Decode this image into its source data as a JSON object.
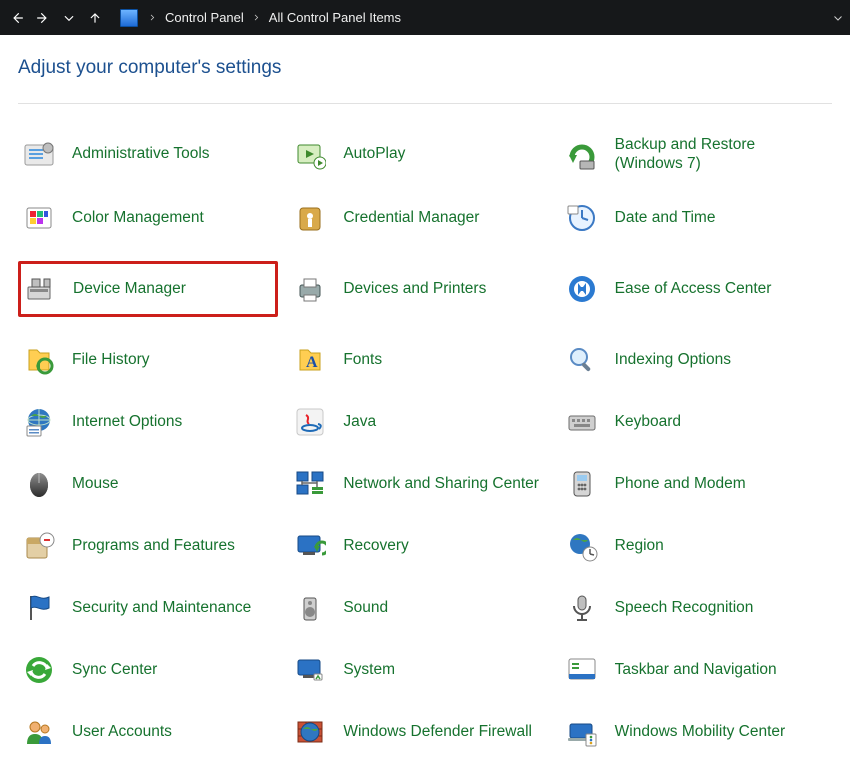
{
  "nav": {
    "back": "Back",
    "forward": "Forward",
    "recent": "Recent locations",
    "up": "Up"
  },
  "breadcrumb": {
    "root": "Control Panel",
    "leaf": "All Control Panel Items"
  },
  "heading": "Adjust your computer's settings",
  "items": [
    {
      "id": "administrative-tools",
      "label": "Administrative Tools",
      "icon": "admin-tools-icon"
    },
    {
      "id": "autoplay",
      "label": "AutoPlay",
      "icon": "autoplay-icon"
    },
    {
      "id": "backup-restore",
      "label": "Backup and Restore (Windows 7)",
      "icon": "backup-icon"
    },
    {
      "id": "color-management",
      "label": "Color Management",
      "icon": "color-icon"
    },
    {
      "id": "credential-manager",
      "label": "Credential Manager",
      "icon": "credential-icon"
    },
    {
      "id": "date-time",
      "label": "Date and Time",
      "icon": "clock-icon"
    },
    {
      "id": "device-manager",
      "label": "Device Manager",
      "icon": "device-manager-icon",
      "highlight": true
    },
    {
      "id": "devices-printers",
      "label": "Devices and Printers",
      "icon": "printer-icon"
    },
    {
      "id": "ease-of-access",
      "label": "Ease of Access Center",
      "icon": "ease-access-icon"
    },
    {
      "id": "file-history",
      "label": "File History",
      "icon": "file-history-icon"
    },
    {
      "id": "fonts",
      "label": "Fonts",
      "icon": "font-icon"
    },
    {
      "id": "indexing-options",
      "label": "Indexing Options",
      "icon": "indexing-icon"
    },
    {
      "id": "internet-options",
      "label": "Internet Options",
      "icon": "globe-icon"
    },
    {
      "id": "java",
      "label": "Java",
      "icon": "java-icon"
    },
    {
      "id": "keyboard",
      "label": "Keyboard",
      "icon": "keyboard-icon"
    },
    {
      "id": "mouse",
      "label": "Mouse",
      "icon": "mouse-icon"
    },
    {
      "id": "network-sharing",
      "label": "Network and Sharing Center",
      "icon": "network-icon"
    },
    {
      "id": "phone-modem",
      "label": "Phone and Modem",
      "icon": "phone-icon"
    },
    {
      "id": "programs-features",
      "label": "Programs and Features",
      "icon": "programs-icon"
    },
    {
      "id": "recovery",
      "label": "Recovery",
      "icon": "recovery-icon"
    },
    {
      "id": "region",
      "label": "Region",
      "icon": "region-icon"
    },
    {
      "id": "security-maintenance",
      "label": "Security and Maintenance",
      "icon": "flag-icon"
    },
    {
      "id": "sound",
      "label": "Sound",
      "icon": "speaker-icon"
    },
    {
      "id": "speech-recognition",
      "label": "Speech Recognition",
      "icon": "mic-icon"
    },
    {
      "id": "sync-center",
      "label": "Sync Center",
      "icon": "sync-icon"
    },
    {
      "id": "system",
      "label": "System",
      "icon": "system-icon"
    },
    {
      "id": "taskbar-navigation",
      "label": "Taskbar and Navigation",
      "icon": "taskbar-icon"
    },
    {
      "id": "user-accounts",
      "label": "User Accounts",
      "icon": "users-icon"
    },
    {
      "id": "windows-defender",
      "label": "Windows Defender Firewall",
      "icon": "firewall-icon"
    },
    {
      "id": "windows-mobility",
      "label": "Windows Mobility Center",
      "icon": "mobility-icon"
    }
  ]
}
